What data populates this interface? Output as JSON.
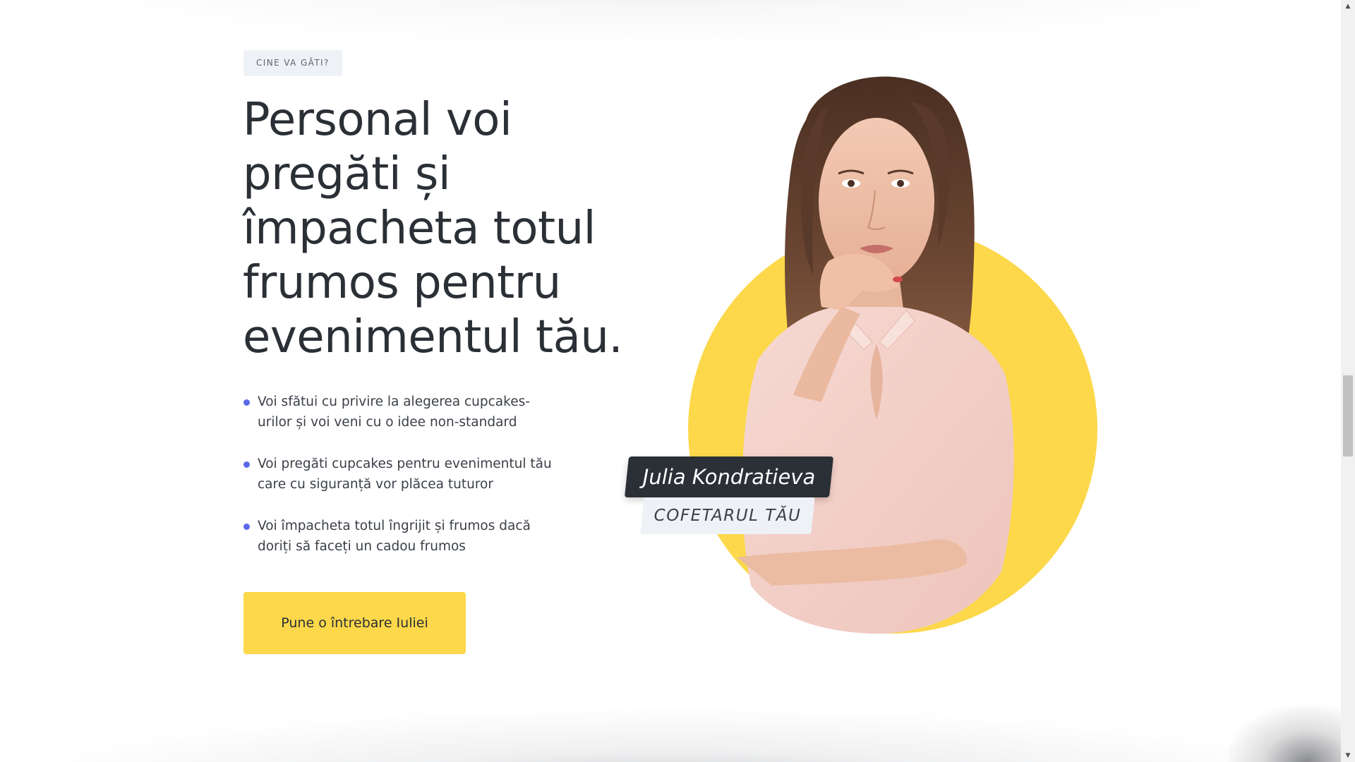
{
  "section": {
    "eyebrow": "CINE VA GĂTI?",
    "heading": "Personal voi pregăti și împacheta totul frumos pentru evenimentul tău.",
    "benefits": [
      "Voi sfătui cu privire la alegerea cupcakes-urilor și voi veni cu o idee non-standard",
      "Voi pregăti cupcakes pentru evenimentul tău care cu siguranță vor plăcea tuturor",
      "Voi împacheta totul îngrijit și frumos dacă doriți să faceți un cadou frumos"
    ],
    "cta_label": "Pune o întrebare Iuliei"
  },
  "person": {
    "name": "Julia Kondratieva",
    "role": "COFETARUL TĂU"
  },
  "colors": {
    "accent_yellow": "#fcd84a",
    "bullet_blue": "#5b6ae8",
    "text_dark": "#2b2f36",
    "tag_bg": "#eef1f6",
    "blouse_pink": "#f2cfc8"
  },
  "icons": {
    "scroll_up": "scroll-up-arrow-icon",
    "scroll_down": "scroll-down-arrow-icon"
  }
}
